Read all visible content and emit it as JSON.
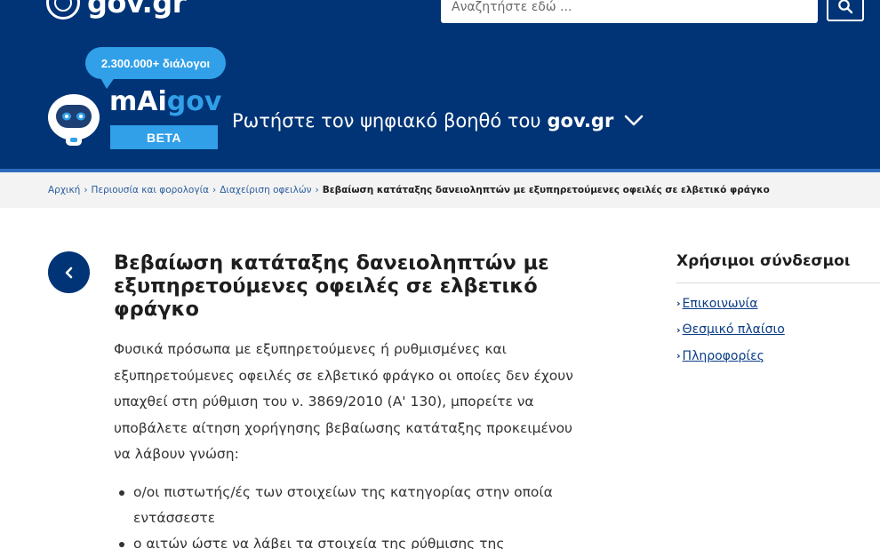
{
  "header": {
    "logo_text": "gov.gr",
    "search": {
      "placeholder": "Αναζητήστε εδώ ..."
    }
  },
  "assistant": {
    "badge": "2.300.000+ διάλογοι",
    "name_prefix": "mAi",
    "name_suffix": "gov",
    "beta": "BETA",
    "prompt": "Ρωτήστε τον ψηφιακό βοηθό του",
    "prompt_brand": "gov.gr"
  },
  "breadcrumb": {
    "items": [
      "Αρχική",
      "Περιουσία και φορολογία",
      "Διαχείριση οφειλών"
    ],
    "current": "Βεβαίωση κατάταξης δανειοληπτών με εξυπηρετούμενες οφειλές σε ελβετικό φράγκο"
  },
  "main": {
    "title": "Βεβαίωση κατάταξης δανειοληπτών με εξυπηρετούμενες οφειλές σε ελβετικό φράγκο",
    "lead": "Φυσικά πρόσωπα με εξυπηρετούμενες ή ρυθμισμένες και εξυπηρετούμενες οφειλές σε ελβετικό φράγκο οι οποίες δεν έχουν υπαχθεί στη ρύθμιση του ν. 3869/2010 (Α' 130), μπορείτε να υποβάλετε αίτηση χορήγησης βεβαίωσης κατάταξης προκειμένου να λάβουν γνώση:",
    "bullets": [
      "ο/οι πιστωτής/ές των στοιχείων της κατηγορίας στην οποία εντάσσεστε",
      "ο αιτών ώστε να λάβει τα στοιχεία της ρύθμισης της"
    ]
  },
  "sidebar": {
    "title": "Χρήσιμοι σύνδεσμοι",
    "links": [
      "Επικοινωνία",
      "Θεσμικό πλαίσιο",
      "Πληροφορίες"
    ]
  },
  "colors": {
    "brand_blue": "#003476",
    "accent_blue": "#31a0e8",
    "link_blue": "#0a3c86"
  },
  "icons": [
    "government-seal-icon",
    "search-icon",
    "robot-icon",
    "chevron-down-icon",
    "chevron-left-icon",
    "chevron-right-icon"
  ]
}
